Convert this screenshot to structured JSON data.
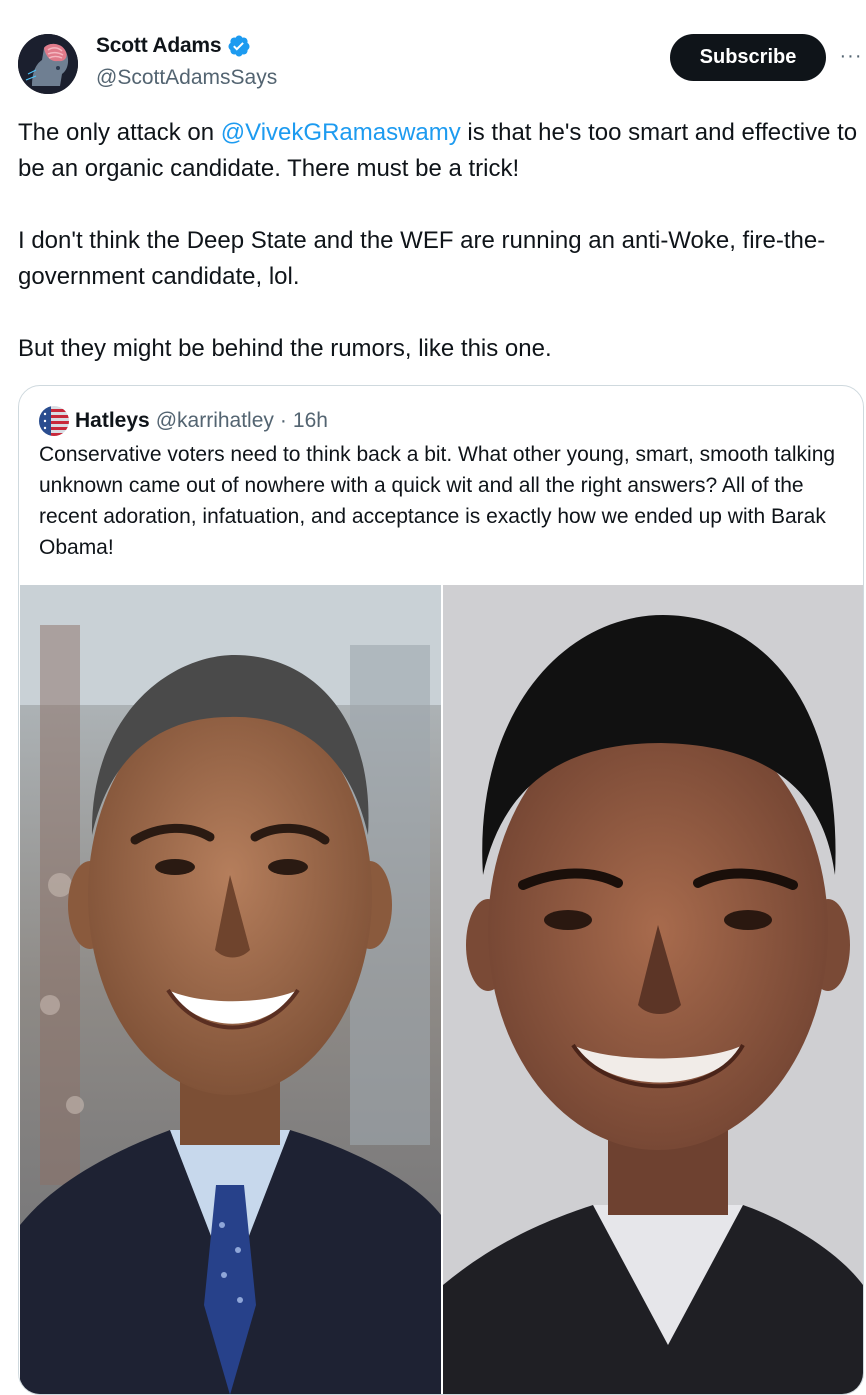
{
  "author": {
    "display_name": "Scott Adams",
    "handle": "@ScottAdamsSays",
    "verified": true,
    "avatar_icon": "brain-head-avatar"
  },
  "actions": {
    "subscribe_label": "Subscribe",
    "more_label": "···"
  },
  "tweet": {
    "paragraph1_before": "The only attack on ",
    "paragraph1_mention": "@VivekGRamaswamy",
    "paragraph1_after": " is that he's  too smart and effective to be an organic candidate. There must be a trick!",
    "paragraph2": "I don't think the Deep State and the WEF are running an anti-Woke, fire-the-government candidate, lol.",
    "paragraph3": "But they might be behind the rumors, like this one."
  },
  "quoted_tweet": {
    "display_name": "Hatleys",
    "handle": "@karrihatley",
    "separator": "·",
    "time": "16h",
    "avatar_icon": "flag-avatar",
    "text": "Conservative voters need to think back a bit. What other young, smart, smooth talking unknown came out of nowhere with a quick wit and all the right answers? All of the recent adoration, infatuation, and acceptance is exactly how we ended up with Barak Obama!",
    "images": [
      "portrait-photo-left",
      "portrait-photo-right"
    ]
  },
  "colors": {
    "text": "#0f1419",
    "secondary_text": "#536471",
    "link": "#1d9bf0",
    "button_bg": "#0f1419",
    "border": "#cfd9de"
  }
}
